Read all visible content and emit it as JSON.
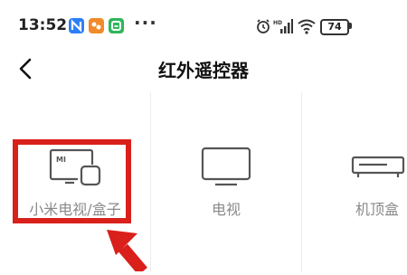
{
  "status_bar": {
    "time": "13:52",
    "battery": "74",
    "app_icons": [
      "notes-app-icon",
      "orange-app-icon",
      "green-app-icon"
    ],
    "more": "···",
    "colors": {
      "notes": "#2c7ef8",
      "orange": "#f08a2a",
      "green": "#2fb75b"
    }
  },
  "header": {
    "back_icon": "chevron-left-icon",
    "title": "红外遥控器"
  },
  "devices": [
    {
      "label": "小米电视/盒子",
      "icon": "mi-tv-box-icon",
      "icon_text": "MI"
    },
    {
      "label": "电视",
      "icon": "tv-icon"
    },
    {
      "label": "机顶盒",
      "icon": "set-top-box-icon"
    }
  ],
  "annotation": {
    "color": "#d9201b"
  }
}
